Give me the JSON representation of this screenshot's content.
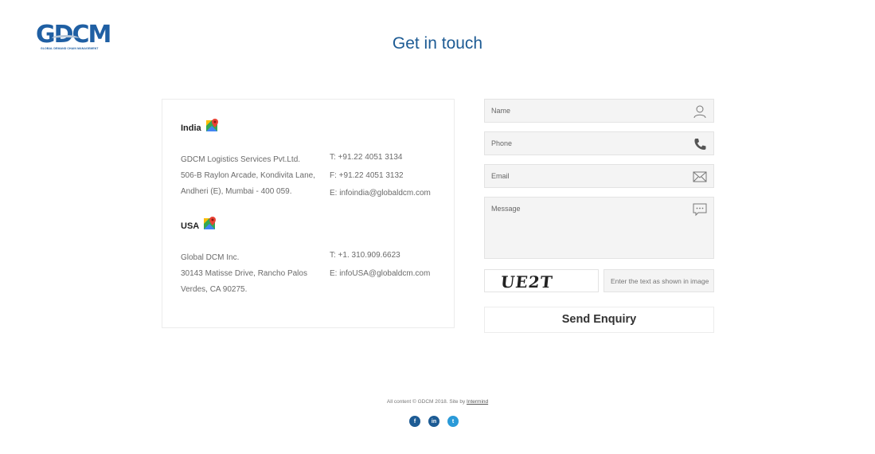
{
  "logo": {
    "letters": "GDCM",
    "tagline": "GLOBAL DEMAND CHAIN MANAGEMENT"
  },
  "page_title": "Get in touch",
  "offices": [
    {
      "region": "India",
      "address": [
        "GDCM Logistics Services Pvt.Ltd.",
        "506-B Raylon Arcade, Kondivita Lane,",
        "Andheri (E), Mumbai - 400 059."
      ],
      "contacts": [
        "T: +91.22 4051 3134",
        "F: +91.22 4051 3132",
        "E: infoindia@globaldcm.com"
      ]
    },
    {
      "region": "USA",
      "address": [
        "Global DCM Inc.",
        "30143 Matisse Drive, Rancho Palos",
        "Verdes, CA 90275."
      ],
      "contacts": [
        "T: +1. 310.909.6623",
        "E: infoUSA@globaldcm.com"
      ]
    }
  ],
  "form": {
    "name_placeholder": "Name",
    "phone_placeholder": "Phone",
    "email_placeholder": "Email",
    "message_placeholder": "Message",
    "captcha_text": "UE2T",
    "captcha_placeholder": "Enter the text as shown in image",
    "submit_label": "Send Enquiry"
  },
  "footer": {
    "copyright": "All content © GDCM 2018. Site by ",
    "credit_link": "Intermind",
    "social": [
      {
        "name": "facebook-icon",
        "glyph": "f"
      },
      {
        "name": "linkedin-icon",
        "glyph": "in"
      },
      {
        "name": "twitter-icon",
        "glyph": "t"
      }
    ]
  },
  "colors": {
    "brand_blue": "#1d5b94",
    "twitter_blue": "#2a9ad8",
    "field_bg": "#f4f4f4"
  }
}
